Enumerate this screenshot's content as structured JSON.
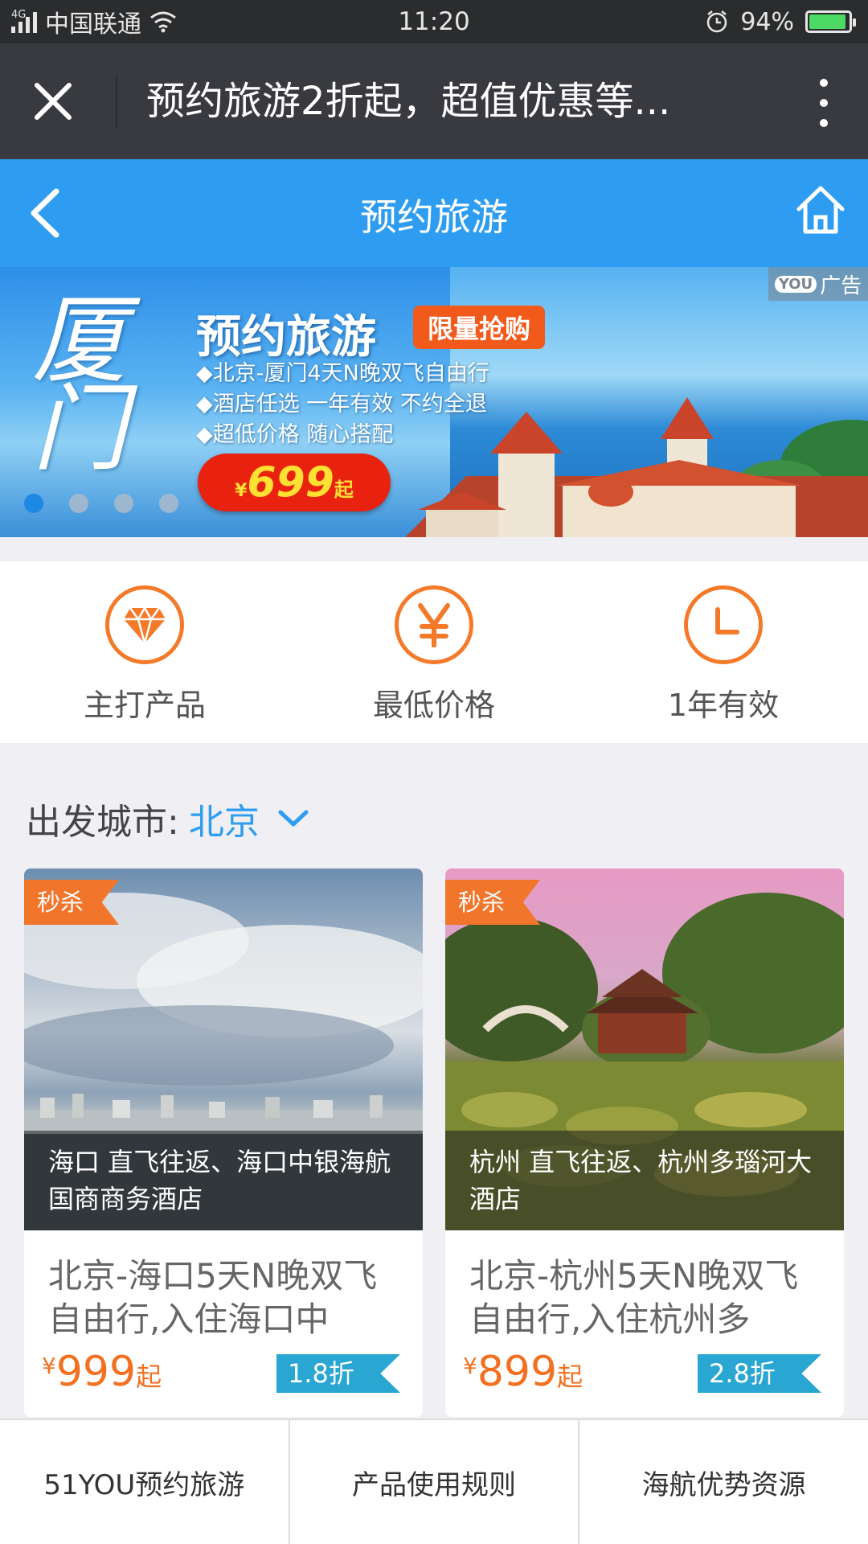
{
  "status_bar": {
    "network": "4G",
    "carrier": "中国联通",
    "time": "11:20",
    "battery": "94%",
    "battery_level": 0.94
  },
  "browser": {
    "title": "预约旅游2折起，超值优惠等..."
  },
  "header": {
    "title": "预约旅游"
  },
  "banner": {
    "ad_label": "广告",
    "ad_brand": "YOU",
    "city_art": "厦门",
    "headline": "预约旅游",
    "tag": "限量抢购",
    "lines": [
      "◆北京-厦门4天N晚双飞自由行",
      "◆酒店任选 一年有效 不约全退",
      "◆超低价格 随心搭配"
    ],
    "price_currency": "¥",
    "price": "699",
    "price_suffix": "起",
    "active_dot": 0,
    "dot_count": 4
  },
  "features": [
    {
      "label": "主打产品",
      "icon": "diamond-icon"
    },
    {
      "label": "最低价格",
      "icon": "yen-icon"
    },
    {
      "label": "1年有效",
      "icon": "clock-icon"
    }
  ],
  "city": {
    "label": "出发城市:",
    "value": "北京"
  },
  "products": [
    {
      "badge": "秒杀",
      "caption": "海口 直飞往返、海口中银海航国商商务酒店",
      "title": "北京-海口5天N晚双飞自由行,入住海口中",
      "currency": "¥",
      "price": "999",
      "price_suffix": "起",
      "discount": "1.8折"
    },
    {
      "badge": "秒杀",
      "caption": "杭州 直飞往返、杭州多瑙河大酒店",
      "title": "北京-杭州5天N晚双飞自由行,入住杭州多",
      "currency": "¥",
      "price": "899",
      "price_suffix": "起",
      "discount": "2.8折"
    }
  ],
  "bottom_nav": [
    {
      "label": "51YOU预约旅游"
    },
    {
      "label": "产品使用规则"
    },
    {
      "label": "海航优势资源"
    }
  ],
  "colors": {
    "accent_blue": "#2e9cf0",
    "accent_orange": "#f47a2a",
    "discount_blue": "#2aa6d2"
  }
}
